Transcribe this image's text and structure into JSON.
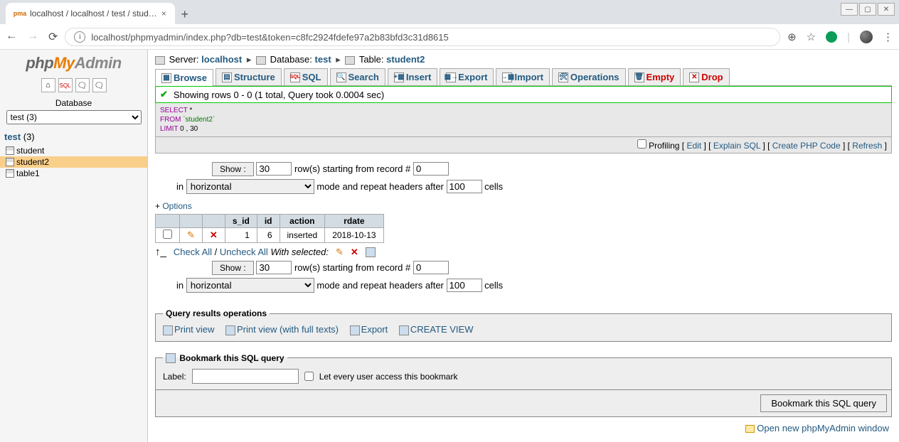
{
  "browser": {
    "tab_title": "localhost / localhost / test / stud…",
    "url": "localhost/phpmyadmin/index.php?db=test&token=c8fc2924fdefe97a2b83bfd3c31d8615"
  },
  "sidebar": {
    "db_label": "Database",
    "db_select_value": "test (3)",
    "current_db": "test",
    "current_db_count": "(3)",
    "tables": [
      "student",
      "student2",
      "table1"
    ],
    "selected_table_index": 1
  },
  "breadcrumb": {
    "server_label": "Server:",
    "server": "localhost",
    "database_label": "Database:",
    "database": "test",
    "table_label": "Table:",
    "table": "student2"
  },
  "tabs": [
    {
      "label": "Browse",
      "active": true
    },
    {
      "label": "Structure"
    },
    {
      "label": "SQL"
    },
    {
      "label": "Search"
    },
    {
      "label": "Insert"
    },
    {
      "label": "Export"
    },
    {
      "label": "Import"
    },
    {
      "label": "Operations"
    },
    {
      "label": "Empty",
      "red": true
    },
    {
      "label": "Drop",
      "red": true
    }
  ],
  "notice": "Showing rows 0 - 0 (1 total, Query took 0.0004 sec)",
  "sql": {
    "l1a": "SELECT",
    "l1b": " *",
    "l2a": "FROM ",
    "l2b": "`student2`",
    "l3a": "LIMIT",
    "l3b": " 0 , 30"
  },
  "sql_actions": {
    "profiling": "Profiling",
    "edit": "Edit",
    "explain": "Explain SQL",
    "create_php": "Create PHP Code",
    "refresh": "Refresh"
  },
  "controls": {
    "show_btn": "Show :",
    "rows": "30",
    "rows_after": "row(s) starting from record #",
    "start": "0",
    "in": "in",
    "mode": "horizontal",
    "mode_after": "mode and repeat headers after",
    "repeat": "100",
    "cells": "cells"
  },
  "options_link": "Options",
  "table": {
    "headers": [
      "s_id",
      "id",
      "action",
      "rdate"
    ],
    "row": {
      "s_id": "1",
      "id": "6",
      "action": "inserted",
      "rdate": "2018-10-13"
    }
  },
  "checkall": {
    "check": "Check All",
    "uncheck": "Uncheck All",
    "with_selected": "With selected:"
  },
  "results_ops": {
    "legend": "Query results operations",
    "print": "Print view",
    "print_full": "Print view (with full texts)",
    "export": "Export",
    "create_view": "CREATE VIEW"
  },
  "bookmark": {
    "legend": "Bookmark this SQL query",
    "label": "Label:",
    "everyone": "Let every user access this bookmark",
    "button": "Bookmark this SQL query"
  },
  "footer": "Open new phpMyAdmin window"
}
